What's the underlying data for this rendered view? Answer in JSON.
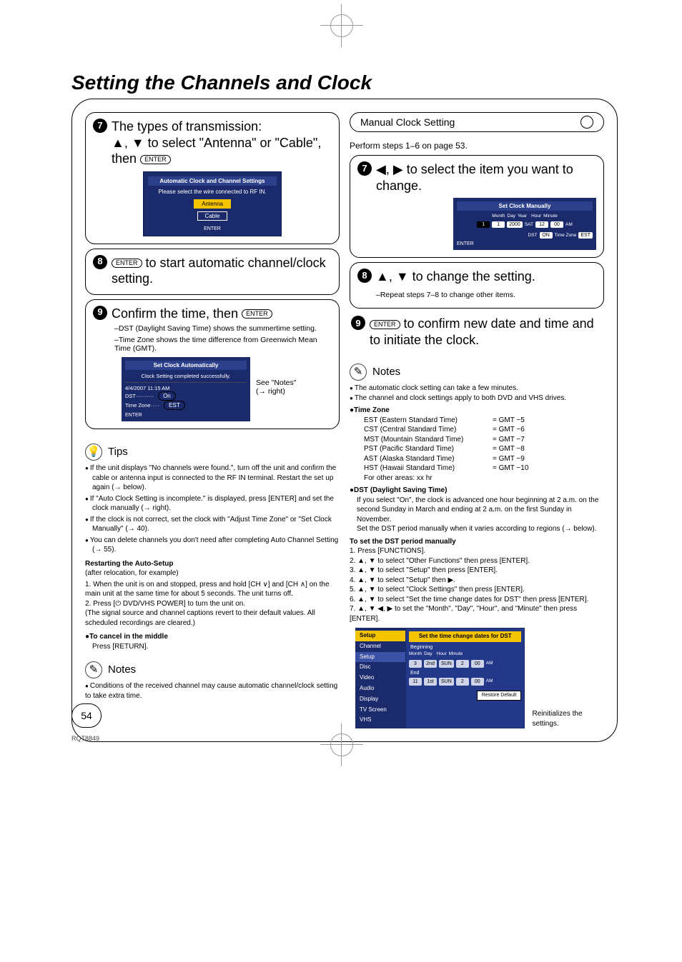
{
  "page_title": "Setting the Channels and Clock",
  "page_number": "54",
  "footer_code": "RQT8849",
  "left": {
    "step7": {
      "line1": "The types of transmission:",
      "line2": "▲, ▼ to select \"Antenna\" or \"Cable\",",
      "line3": "then",
      "osd_header": "Automatic Clock and Channel Settings",
      "osd_prompt": "Please select the wire connected to RF IN.",
      "osd_btn1": "Antenna",
      "osd_btn2": "Cable",
      "osd_foot": "ENTER"
    },
    "step8": {
      "text": " to start automatic channel/clock setting."
    },
    "step9": {
      "head": "Confirm the time, then ",
      "sub1": "–DST (Daylight Saving Time) shows the summertime setting.",
      "sub2": "–Time Zone shows the time difference from Greenwich Mean Time (GMT).",
      "osd_title": "Set Clock Automatically",
      "osd_msg": "Clock Setting completed successfully.",
      "osd_time": "4/4/2007  11:15 AM",
      "osd_dst_label": "DST",
      "osd_dst_val": "On",
      "osd_tz_label": "Time Zone",
      "osd_tz_val": "EST",
      "see_notes": "See \"Notes\"",
      "see_notes2": "(→ right)"
    },
    "tips": {
      "title": "Tips",
      "items": [
        "If the unit displays \"No channels were found.\", turn off the unit and confirm the cable or antenna input is connected to the RF IN terminal. Restart the set up again (→ below).",
        "If \"Auto Clock Setting is incomplete.\" is displayed, press [ENTER] and set the clock manually (→ right).",
        "If the clock is not correct, set the clock with \"Adjust Time Zone\" or \"Set Clock Manually\" (→ 40).",
        "You can delete channels you don't need after completing Auto Channel Setting (→ 55)."
      ],
      "restart_title": "Restarting the Auto-Setup",
      "restart_sub": "(after relocation, for example)",
      "restart_1": "1. When the unit is on and stopped, press and hold [CH ∨] and [CH ∧] on the main unit at the same time for about 5 seconds. The unit turns off.",
      "restart_2": "2. Press [⏻ DVD/VHS POWER] to turn the unit on.",
      "restart_note": "(The signal source and channel captions revert to their default values. All scheduled recordings are cleared.)",
      "cancel_title": "●To cancel in the middle",
      "cancel_action": "Press [RETURN]."
    },
    "notes": {
      "title": "Notes",
      "text": "Conditions of the received channel may cause automatic channel/clock setting to take extra time."
    }
  },
  "right": {
    "section_title": "Manual Clock Setting",
    "pre_text": "Perform steps 1–6 on page 53.",
    "step7": {
      "text": "◀, ▶ to select the item you want to change.",
      "osd_title": "Set Clock Manually",
      "labels": [
        "Month",
        "Day",
        "Year",
        "Hour",
        "Minute"
      ],
      "vals": [
        "1",
        "1",
        "2000",
        "SAT",
        "12",
        "00",
        "AM"
      ],
      "dst_label": "DST",
      "dst_val": "ON",
      "tz_label": "Time Zone",
      "tz_val": "EST"
    },
    "step8": {
      "text": "▲, ▼ to change the setting.",
      "sub": "–Repeat steps 7–8 to change other items."
    },
    "step9": {
      "text": " to confirm new date and time and to initiate the clock."
    },
    "notes": {
      "title": "Notes",
      "n1": "The automatic clock setting can take a few minutes.",
      "n2": "The channel and clock settings apply to both DVD and VHS drives.",
      "tz_title": "●Time Zone",
      "tz": [
        {
          "name": "EST (Eastern Standard Time)",
          "gmt": "= GMT −5"
        },
        {
          "name": "CST (Central Standard Time)",
          "gmt": "= GMT −6"
        },
        {
          "name": "MST (Mountain Standard Time)",
          "gmt": "= GMT −7"
        },
        {
          "name": "PST (Pacific Standard Time)",
          "gmt": "= GMT −8"
        },
        {
          "name": "AST (Alaska Standard Time)",
          "gmt": "= GMT −9"
        },
        {
          "name": "HST (Hawaii Standard Time)",
          "gmt": "= GMT −10"
        }
      ],
      "tz_other": "For other areas: xx hr",
      "dst_title": "●DST (Daylight Saving Time)",
      "dst_body1": "If you select \"On\", the clock is advanced one hour beginning at 2 a.m. on the second Sunday in March and ending at 2 a.m. on the first Sunday in November.",
      "dst_body2": "Set the DST period manually when it varies according to regions (→ below).",
      "dst_proc_title": "To set the DST period manually",
      "dst_steps": [
        "1. Press [FUNCTIONS].",
        "2. ▲, ▼ to select \"Other Functions\" then press [ENTER].",
        "3. ▲, ▼ to select \"Setup\" then press [ENTER].",
        "4. ▲, ▼ to select \"Setup\" then ▶.",
        "5. ▲, ▼ to select \"Clock Settings\" then press [ENTER].",
        "6. ▲, ▼ to select \"Set the time change dates for DST\" then press [ENTER].",
        "7. ▲, ▼ ◀, ▶ to set the \"Month\", \"Day\", \"Hour\", and \"Minute\" then press [ENTER]."
      ]
    },
    "setup_osd": {
      "side_header": "Setup",
      "side_items": [
        "Channel",
        "Setup",
        "Disc",
        "Video",
        "Audio",
        "Display",
        "TV Screen",
        "VHS"
      ],
      "panel_title": "Set the time change dates for DST",
      "begin_label": "Beginning",
      "end_label": "End",
      "cols": [
        "Month",
        "Day",
        "",
        "Hour",
        "Minute",
        ""
      ],
      "row1": [
        "3",
        "2nd",
        "SUN",
        "2",
        "00",
        "AM"
      ],
      "row2": [
        "11",
        "1st",
        "SUN",
        "2",
        "00",
        "AM"
      ],
      "restore": "Restore Default"
    },
    "reinit": "Reinitializes the settings."
  }
}
